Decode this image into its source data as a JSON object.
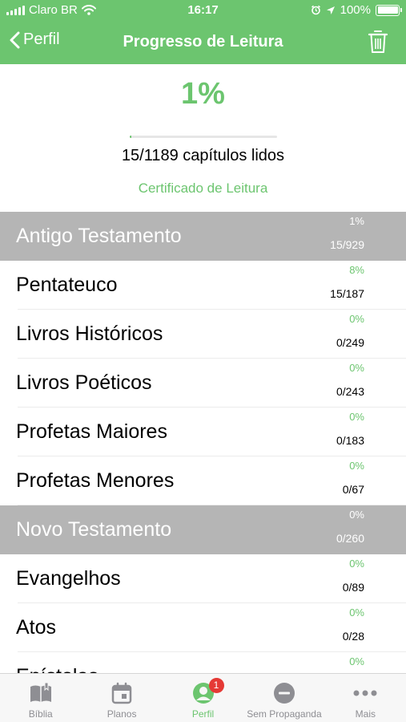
{
  "status_bar": {
    "carrier": "Claro BR",
    "time": "16:17",
    "battery": "100%"
  },
  "nav": {
    "back_label": "Perfil",
    "title": "Progresso de Leitura"
  },
  "summary": {
    "percent": "1%",
    "progress_fraction": 0.0126,
    "chapters_read": "15/1189 capítulos lidos",
    "certificate_link": "Certificado de Leitura"
  },
  "sections": [
    {
      "name": "Antigo Testamento",
      "percent": "1%",
      "count": "15/929"
    },
    {
      "name": "Pentateuco",
      "percent": "8%",
      "count": "15/187"
    },
    {
      "name": "Livros Históricos",
      "percent": "0%",
      "count": "0/249"
    },
    {
      "name": "Livros Poéticos",
      "percent": "0%",
      "count": "0/243"
    },
    {
      "name": "Profetas Maiores",
      "percent": "0%",
      "count": "0/183"
    },
    {
      "name": "Profetas Menores",
      "percent": "0%",
      "count": "0/67"
    },
    {
      "name": "Novo Testamento",
      "percent": "0%",
      "count": "0/260"
    },
    {
      "name": "Evangelhos",
      "percent": "0%",
      "count": "0/89"
    },
    {
      "name": "Atos",
      "percent": "0%",
      "count": "0/28"
    },
    {
      "name": "Epístolas",
      "percent": "0%",
      "count": ""
    }
  ],
  "tabs": [
    {
      "label": "Bíblia",
      "icon": "bible-icon"
    },
    {
      "label": "Planos",
      "icon": "calendar-icon"
    },
    {
      "label": "Perfil",
      "icon": "profile-icon",
      "badge": "1"
    },
    {
      "label": "Sem Propaganda",
      "icon": "no-ads-icon"
    },
    {
      "label": "Mais",
      "icon": "more-icon"
    }
  ],
  "colors": {
    "accent": "#6cc56f",
    "section_header": "#b5b5b5",
    "badge": "#e53935",
    "tab_inactive": "#8e8e93"
  }
}
